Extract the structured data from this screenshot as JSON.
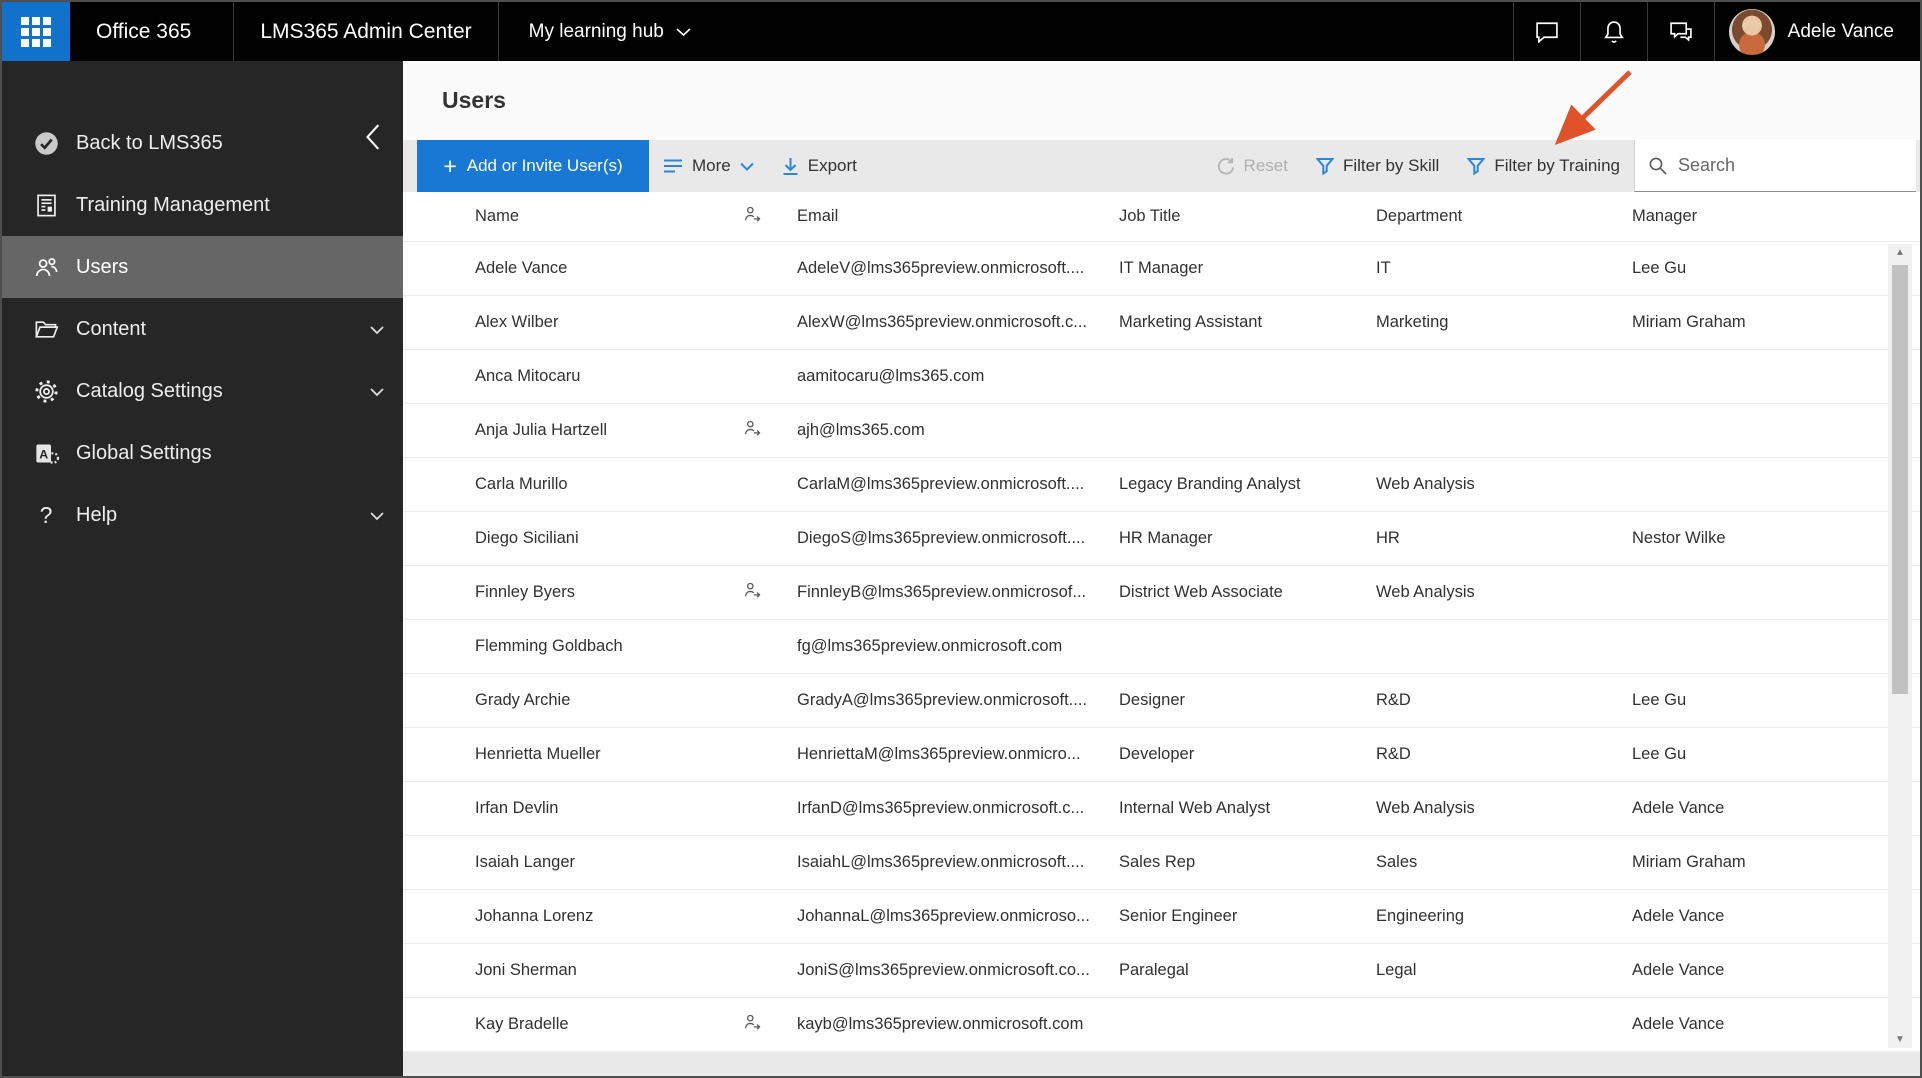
{
  "topbar": {
    "product_label": "Office 365",
    "app_title": "LMS365 Admin Center",
    "hub_menu_label": "My learning hub",
    "user_name": "Adele Vance",
    "icons": [
      "app-launcher-icon",
      "chat-icon",
      "bell-icon",
      "feedback-icon"
    ]
  },
  "sidebar": {
    "collapse_icon": "chevron-left-icon",
    "items": [
      {
        "label": "Back to LMS365",
        "icon": "check-circle-icon",
        "selected": false,
        "expandable": false
      },
      {
        "label": "Training Management",
        "icon": "training-report-icon",
        "selected": false,
        "expandable": false
      },
      {
        "label": "Users",
        "icon": "people-icon",
        "selected": true,
        "expandable": false
      },
      {
        "label": "Content",
        "icon": "folder-icon",
        "selected": false,
        "expandable": true
      },
      {
        "label": "Catalog Settings",
        "icon": "gear-icon",
        "selected": false,
        "expandable": true
      },
      {
        "label": "Global Settings",
        "icon": "global-settings-icon",
        "selected": false,
        "expandable": false
      },
      {
        "label": "Help",
        "icon": "question-icon",
        "selected": false,
        "expandable": true
      }
    ]
  },
  "main": {
    "page_title": "Users",
    "toolbar": {
      "add_button_label": "Add or Invite User(s)",
      "more_label": "More",
      "export_label": "Export",
      "reset_label": "Reset",
      "reset_disabled": true,
      "filter_by_skill_label": "Filter by Skill",
      "filter_by_training_label": "Filter by Training",
      "search_placeholder": "Search"
    },
    "table": {
      "columns": [
        "Name",
        "Email",
        "Job Title",
        "Department",
        "Manager"
      ],
      "header_guest_icon": "person-arrow-icon",
      "rows": [
        {
          "name": "Adele Vance",
          "guest": false,
          "email": "AdeleV@lms365preview.onmicrosoft....",
          "job": "IT Manager",
          "dept": "IT",
          "manager": "Lee Gu"
        },
        {
          "name": "Alex Wilber",
          "guest": false,
          "email": "AlexW@lms365preview.onmicrosoft.c...",
          "job": "Marketing Assistant",
          "dept": "Marketing",
          "manager": "Miriam Graham"
        },
        {
          "name": "Anca Mitocaru",
          "guest": false,
          "email": "aamitocaru@lms365.com",
          "job": "",
          "dept": "",
          "manager": ""
        },
        {
          "name": "Anja Julia Hartzell",
          "guest": true,
          "email": "ajh@lms365.com",
          "job": "",
          "dept": "",
          "manager": ""
        },
        {
          "name": "Carla Murillo",
          "guest": false,
          "email": "CarlaM@lms365preview.onmicrosoft....",
          "job": "Legacy Branding Analyst",
          "dept": "Web Analysis",
          "manager": ""
        },
        {
          "name": "Diego Siciliani",
          "guest": false,
          "email": "DiegoS@lms365preview.onmicrosoft....",
          "job": "HR Manager",
          "dept": "HR",
          "manager": "Nestor Wilke"
        },
        {
          "name": "Finnley Byers",
          "guest": true,
          "email": "FinnleyB@lms365preview.onmicrosof...",
          "job": "District Web Associate",
          "dept": "Web Analysis",
          "manager": ""
        },
        {
          "name": "Flemming Goldbach",
          "guest": false,
          "email": "fg@lms365preview.onmicrosoft.com",
          "job": "",
          "dept": "",
          "manager": ""
        },
        {
          "name": "Grady Archie",
          "guest": false,
          "email": "GradyA@lms365preview.onmicrosoft....",
          "job": "Designer",
          "dept": "R&D",
          "manager": "Lee Gu"
        },
        {
          "name": "Henrietta Mueller",
          "guest": false,
          "email": "HenriettaM@lms365preview.onmicro...",
          "job": "Developer",
          "dept": "R&D",
          "manager": "Lee Gu"
        },
        {
          "name": "Irfan Devlin",
          "guest": false,
          "email": "IrfanD@lms365preview.onmicrosoft.c...",
          "job": "Internal Web Analyst",
          "dept": "Web Analysis",
          "manager": "Adele Vance"
        },
        {
          "name": "Isaiah Langer",
          "guest": false,
          "email": "IsaiahL@lms365preview.onmicrosoft....",
          "job": "Sales Rep",
          "dept": "Sales",
          "manager": "Miriam Graham"
        },
        {
          "name": "Johanna Lorenz",
          "guest": false,
          "email": "JohannaL@lms365preview.onmicroso...",
          "job": "Senior Engineer",
          "dept": "Engineering",
          "manager": "Adele Vance"
        },
        {
          "name": "Joni Sherman",
          "guest": false,
          "email": "JoniS@lms365preview.onmicrosoft.co...",
          "job": "Paralegal",
          "dept": "Legal",
          "manager": "Adele Vance"
        },
        {
          "name": "Kay Bradelle",
          "guest": true,
          "email": "kayb@lms365preview.onmicrosoft.com",
          "job": "",
          "dept": "",
          "manager": "Adele Vance"
        }
      ]
    }
  },
  "annotation": {
    "type": "arrow",
    "points_to": "Filter by Training",
    "color": "#e0532a"
  },
  "colors": {
    "accent_blue": "#1878d4",
    "icon_blue": "#2b88d8",
    "topbar_bg": "#020202",
    "sidebar_bg": "#262626",
    "sidebar_selected": "#666667",
    "toolbar_bg": "#e9e9e9",
    "annotation_arrow": "#e0532a"
  }
}
